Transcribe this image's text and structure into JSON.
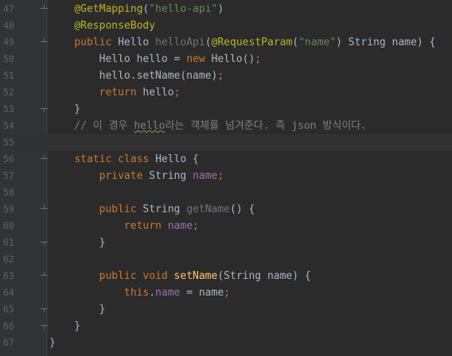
{
  "editor": {
    "colors": {
      "background": "#2b2b2b",
      "gutter": "#313335",
      "line_number": "#606366",
      "keyword": "#cc7832",
      "string": "#6a8759",
      "annotation": "#bbb529",
      "field": "#9876aa",
      "method_decl": "#ffc66d",
      "comment": "#808080",
      "default_text": "#a9b7c6"
    },
    "current_line": 55,
    "lines": [
      {
        "n": "47",
        "fold": "start",
        "tokens": [
          {
            "t": "    ",
            "c": "plain"
          },
          {
            "t": "@GetMapping",
            "c": "ann"
          },
          {
            "t": "(",
            "c": "plain"
          },
          {
            "t": "\"hello-api\"",
            "c": "str"
          },
          {
            "t": ")",
            "c": "plain"
          }
        ]
      },
      {
        "n": "48",
        "fold": "",
        "tokens": [
          {
            "t": "    ",
            "c": "plain"
          },
          {
            "t": "@ResponseBody",
            "c": "ann"
          }
        ]
      },
      {
        "n": "49",
        "fold": "start",
        "tokens": [
          {
            "t": "    ",
            "c": "plain"
          },
          {
            "t": "public ",
            "c": "kw"
          },
          {
            "t": "Hello ",
            "c": "plain"
          },
          {
            "t": "helloApi",
            "c": "unused"
          },
          {
            "t": "(",
            "c": "plain"
          },
          {
            "t": "@RequestParam",
            "c": "ann"
          },
          {
            "t": "(",
            "c": "plain"
          },
          {
            "t": "\"name\"",
            "c": "str"
          },
          {
            "t": ") String name) {",
            "c": "plain"
          }
        ]
      },
      {
        "n": "50",
        "fold": "",
        "tokens": [
          {
            "t": "        Hello hello = ",
            "c": "plain"
          },
          {
            "t": "new ",
            "c": "kw"
          },
          {
            "t": "Hello()",
            "c": "plain"
          },
          {
            "t": ";",
            "c": "kw"
          }
        ]
      },
      {
        "n": "51",
        "fold": "",
        "tokens": [
          {
            "t": "        hello.setName(name)",
            "c": "plain"
          },
          {
            "t": ";",
            "c": "kw"
          }
        ]
      },
      {
        "n": "52",
        "fold": "",
        "tokens": [
          {
            "t": "        ",
            "c": "plain"
          },
          {
            "t": "return ",
            "c": "kw"
          },
          {
            "t": "hello",
            "c": "plain"
          },
          {
            "t": ";",
            "c": "kw"
          }
        ]
      },
      {
        "n": "53",
        "fold": "end",
        "tokens": [
          {
            "t": "    }",
            "c": "plain"
          }
        ]
      },
      {
        "n": "54",
        "fold": "",
        "tokens": [
          {
            "t": "    // 이 경우 ",
            "c": "cmt"
          },
          {
            "t": "hello",
            "c": "cmt typo"
          },
          {
            "t": "라는 객체를 넘겨준다. 즉 json 방식이다.",
            "c": "cmt"
          }
        ]
      },
      {
        "n": "55",
        "fold": "",
        "tokens": []
      },
      {
        "n": "56",
        "fold": "start",
        "tokens": [
          {
            "t": "    ",
            "c": "plain"
          },
          {
            "t": "static class ",
            "c": "kw"
          },
          {
            "t": "Hello {",
            "c": "plain"
          }
        ]
      },
      {
        "n": "57",
        "fold": "",
        "tokens": [
          {
            "t": "        ",
            "c": "plain"
          },
          {
            "t": "private ",
            "c": "kw"
          },
          {
            "t": "String ",
            "c": "plain"
          },
          {
            "t": "name",
            "c": "fld"
          },
          {
            "t": ";",
            "c": "kw"
          }
        ]
      },
      {
        "n": "58",
        "fold": "",
        "tokens": []
      },
      {
        "n": "59",
        "fold": "start",
        "tokens": [
          {
            "t": "        ",
            "c": "plain"
          },
          {
            "t": "public ",
            "c": "kw"
          },
          {
            "t": "String ",
            "c": "plain"
          },
          {
            "t": "getName",
            "c": "unused"
          },
          {
            "t": "() {",
            "c": "plain"
          }
        ]
      },
      {
        "n": "60",
        "fold": "",
        "tokens": [
          {
            "t": "            ",
            "c": "plain"
          },
          {
            "t": "return ",
            "c": "kw"
          },
          {
            "t": "name",
            "c": "fld"
          },
          {
            "t": ";",
            "c": "kw"
          }
        ]
      },
      {
        "n": "61",
        "fold": "end",
        "tokens": [
          {
            "t": "        }",
            "c": "plain"
          }
        ]
      },
      {
        "n": "62",
        "fold": "",
        "tokens": []
      },
      {
        "n": "63",
        "fold": "start",
        "tokens": [
          {
            "t": "        ",
            "c": "plain"
          },
          {
            "t": "public void ",
            "c": "kw"
          },
          {
            "t": "setName",
            "c": "fn"
          },
          {
            "t": "(String name) {",
            "c": "plain"
          }
        ]
      },
      {
        "n": "64",
        "fold": "",
        "tokens": [
          {
            "t": "            ",
            "c": "plain"
          },
          {
            "t": "this",
            "c": "kw"
          },
          {
            "t": ".",
            "c": "plain"
          },
          {
            "t": "name",
            "c": "fld"
          },
          {
            "t": " = name",
            "c": "plain"
          },
          {
            "t": ";",
            "c": "kw"
          }
        ]
      },
      {
        "n": "65",
        "fold": "end",
        "tokens": [
          {
            "t": "        }",
            "c": "plain"
          }
        ]
      },
      {
        "n": "66",
        "fold": "end",
        "tokens": [
          {
            "t": "    }",
            "c": "plain"
          }
        ]
      },
      {
        "n": "67",
        "fold": "",
        "tokens": [
          {
            "t": "}",
            "c": "plain"
          }
        ]
      }
    ]
  }
}
